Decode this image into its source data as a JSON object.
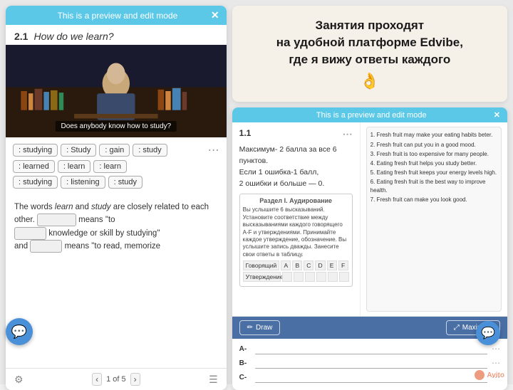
{
  "left_panel": {
    "preview_bar": "This is a preview and edit mode",
    "section_number": "2.1",
    "section_title": "How do we learn?",
    "video_subtitle": "Does anybody know how to study?",
    "chips": [
      [
        "studying",
        "Study",
        "gain",
        "study"
      ],
      [
        "learned",
        "learn",
        "learn"
      ],
      [
        "studying",
        "listening",
        "study"
      ]
    ],
    "text_line1": "The words ",
    "text_italic1": "learn",
    "text_line1b": " and ",
    "text_italic2": "study",
    "text_line1c": " are closely",
    "text_line2": "related to each other.",
    "text_line2b": " means \"to",
    "text_line3": " knowledge or skill by studying\"",
    "text_line4": "and",
    "text_line4b": " means \"to read, memorize",
    "nav_pages": "1 of 5"
  },
  "right_banner": {
    "line1": "Занятия проходят",
    "line2": "на удобной платформе Edvibe,",
    "line3": "где я вижу ответы каждого",
    "emoji": "👌"
  },
  "right_edu": {
    "preview_bar": "This is a preview and edit mode",
    "section_number": "1.1",
    "score_text_line1": "Максимум- 2 балла за все 6",
    "score_text_line2": "пунктов.",
    "score_text_line3": "Если 1 ошибка-1 балл,",
    "score_text_line4": "2 ошибки и больше — 0.",
    "section_title": "Раздел I. Аудирование",
    "listening_items": [
      "1. Fresh fruit may make your eating habits beter.",
      "2. Fresh fruit can put you in a good mood.",
      "3. Fresh fruit is too expensive for many people.",
      "4. Eating fresh fruit helps you study better.",
      "5. Eating fresh fruit keeps your energy levels high.",
      "6. Eating fresh fruit is the best way to improve health.",
      "7. Fresh fruit can make you look good."
    ],
    "table_headers": [
      "Утверждение",
      "A",
      "B",
      "C",
      "D",
      "E",
      "F"
    ],
    "draw_btn": "Draw",
    "maximize_btn": "Maximize",
    "answers": [
      {
        "label": "A-",
        "value": ""
      },
      {
        "label": "B-",
        "value": ""
      },
      {
        "label": "C-",
        "value": ""
      }
    ]
  },
  "avito": "Avito"
}
